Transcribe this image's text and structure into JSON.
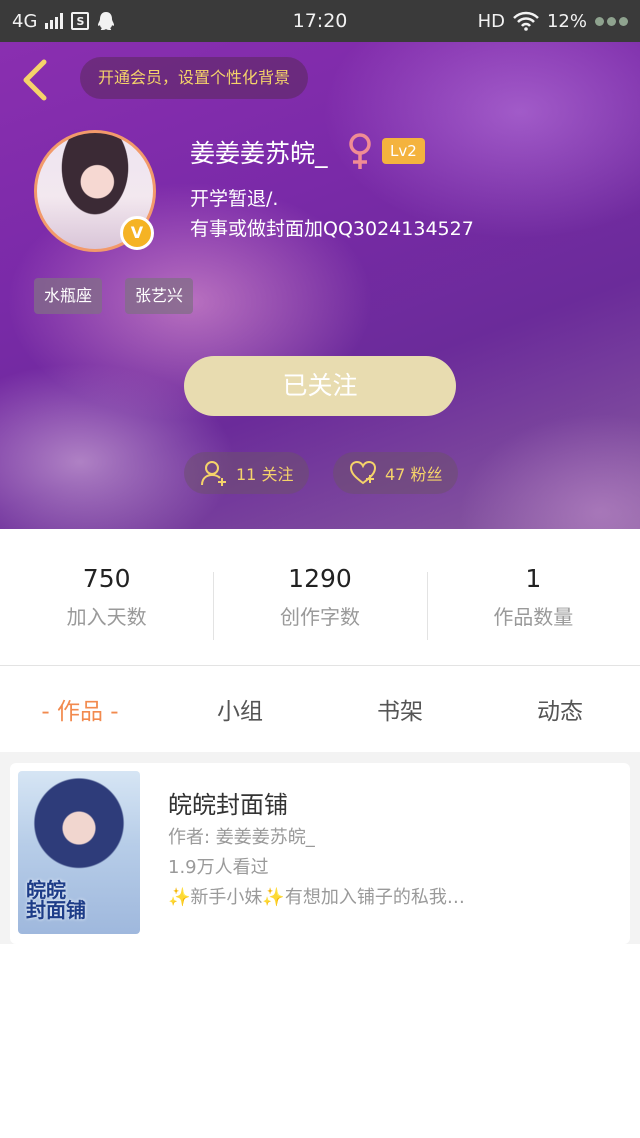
{
  "status_bar": {
    "network": "4G",
    "sim_label": "S",
    "time": "17:20",
    "hd": "HD",
    "battery": "12%"
  },
  "header": {
    "vip_banner": "开通会员，设置个性化背景",
    "username": "姜姜姜苏皖_",
    "level": "Lv2",
    "bio_line1": "开学暂退/.",
    "bio_line2": "有事或做封面加QQ3024134527",
    "tags": [
      "水瓶座",
      "张艺兴"
    ],
    "follow_button": "已关注",
    "following": "11 关注",
    "fans": "47 粉丝",
    "colors": {
      "accent_gold": "#f5d36a",
      "follow_btn": "#e8dcb0",
      "level_badge": "#f4b33e",
      "female": "#f08c94"
    }
  },
  "stats": [
    {
      "value": "750",
      "label": "加入天数"
    },
    {
      "value": "1290",
      "label": "创作字数"
    },
    {
      "value": "1",
      "label": "作品数量"
    }
  ],
  "tabs": [
    {
      "label": "- 作品 -",
      "active": true
    },
    {
      "label": "小组",
      "active": false
    },
    {
      "label": "书架",
      "active": false
    },
    {
      "label": "动态",
      "active": false
    }
  ],
  "works": [
    {
      "title": "皖皖封面铺",
      "author": "作者: 姜姜姜苏皖_",
      "views": "1.9万人看过",
      "desc": "✨新手小妹✨有想加入铺子的私我…",
      "cover_text": "皖皖\n封面铺"
    }
  ]
}
